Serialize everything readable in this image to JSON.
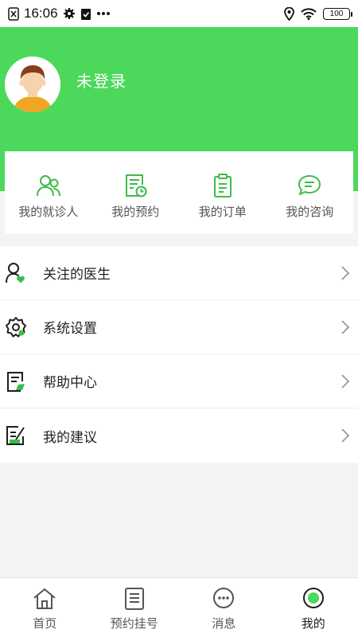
{
  "status_bar": {
    "time": "16:06",
    "battery": "100",
    "icons": [
      "sim-off-icon",
      "gear-icon",
      "clipboard-check-icon",
      "more-dots-icon",
      "location-icon",
      "wifi-icon",
      "battery-icon"
    ]
  },
  "profile": {
    "login_status": "未登录"
  },
  "quick_actions": [
    {
      "label": "我的就诊人",
      "icon": "patients-icon"
    },
    {
      "label": "我的预约",
      "icon": "appointment-icon"
    },
    {
      "label": "我的订单",
      "icon": "order-clipboard-icon"
    },
    {
      "label": "我的咨询",
      "icon": "chat-bubble-icon"
    }
  ],
  "menu": [
    {
      "label": "关注的医生",
      "icon": "followed-doctor-icon"
    },
    {
      "label": "系统设置",
      "icon": "settings-gear-icon"
    },
    {
      "label": "帮助中心",
      "icon": "help-document-icon"
    },
    {
      "label": "我的建议",
      "icon": "suggestion-edit-icon"
    }
  ],
  "tabbar": [
    {
      "label": "首页",
      "icon": "home-icon"
    },
    {
      "label": "预约挂号",
      "icon": "register-list-icon"
    },
    {
      "label": "消息",
      "icon": "message-icon"
    },
    {
      "label": "我的",
      "icon": "profile-icon",
      "active": true
    }
  ],
  "colors": {
    "brand": "#4cd85a",
    "icon_outline": "#1e1e1e",
    "quick_icon": "#3dbb4c"
  }
}
